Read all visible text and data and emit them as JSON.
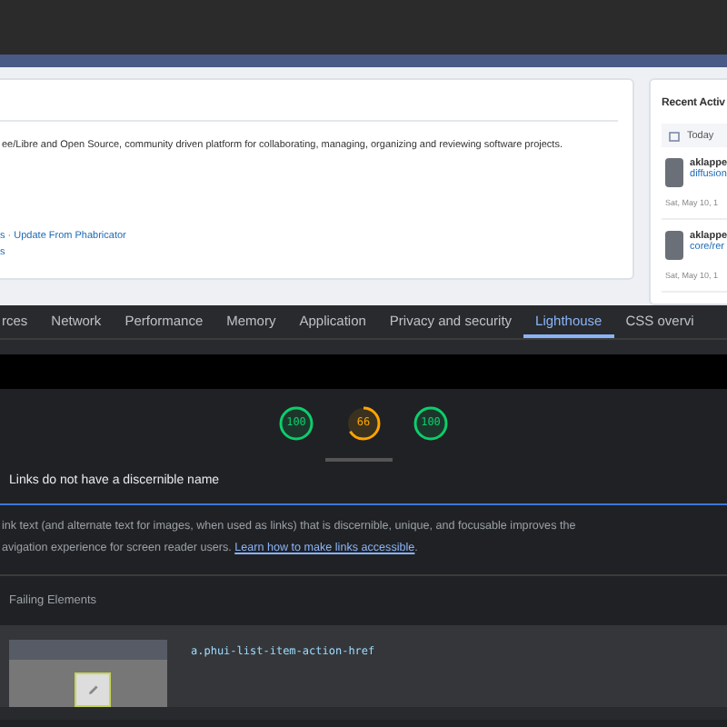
{
  "page": {
    "description": "ee/Libre and Open Source, community driven platform for collaborating, managing, organizing and reviewing software projects.",
    "links": [
      "s · Update From Phabricator",
      "s"
    ],
    "activity": {
      "title": "Recent Activ",
      "day": "Today",
      "items": [
        {
          "user": "aklappe",
          "object": "diffusion",
          "time": "Sat, May 10, 1"
        },
        {
          "user": "aklappe",
          "object": "core/rer",
          "time": "Sat, May 10, 1"
        }
      ]
    }
  },
  "devtools": {
    "tabs": [
      {
        "label": "rces",
        "selected": false
      },
      {
        "label": "Network",
        "selected": false
      },
      {
        "label": "Performance",
        "selected": false
      },
      {
        "label": "Memory",
        "selected": false
      },
      {
        "label": "Application",
        "selected": false
      },
      {
        "label": "Privacy and security",
        "selected": false
      },
      {
        "label": "Lighthouse",
        "selected": true
      },
      {
        "label": "CSS overvi",
        "selected": false
      }
    ],
    "scores": [
      {
        "value": "100",
        "level": 1,
        "color": "#0cce6b"
      },
      {
        "value": "66",
        "level": 0.66,
        "color": "#ffa400"
      },
      {
        "value": "100",
        "level": 1,
        "color": "#0cce6b"
      }
    ],
    "audit": {
      "title": "Links do not have a discernible name",
      "description": [
        "ink text (and alternate text for images, when used as links) that is discernible, unique, and focusable improves the",
        "avigation experience for screen reader users. "
      ],
      "link": "Learn how to make links accessible",
      "after": ".",
      "failing_title": "Failing Elements",
      "selector": "a.phui-list-item-action-href"
    }
  }
}
